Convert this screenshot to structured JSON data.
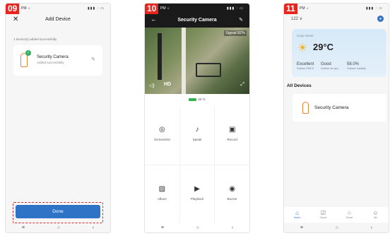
{
  "screens": [
    {
      "step": "09",
      "status": {
        "time": "PM ☼",
        "icons": "▮▮▮ ∶ ▭"
      },
      "header": {
        "close_icon": "✕",
        "title": "Add Device"
      },
      "added_text": "1 device(s) added successfully",
      "device": {
        "name": "Security Camera",
        "status": "Added successfully",
        "edit_icon": "✎"
      },
      "done_label": "Done",
      "nav": [
        "≡",
        "○",
        "‹"
      ]
    },
    {
      "step": "10",
      "status": {
        "time": "PM ☼",
        "icons": "▮▮▮ ∶ ▭"
      },
      "header": {
        "back_icon": "←",
        "title": "Security Camera",
        "edit_icon": "✎"
      },
      "signal": "Signal:92%",
      "hd_label": "HD",
      "battery": "60 %",
      "controls": [
        {
          "icon": "◎",
          "label": "Screenshot"
        },
        {
          "icon": "♪",
          "label": "Speak"
        },
        {
          "icon": "▣",
          "label": "Record"
        },
        {
          "icon": "▨",
          "label": "Album"
        },
        {
          "icon": "▶",
          "label": "Playback"
        },
        {
          "icon": "◉",
          "label": "Buzzer"
        }
      ],
      "nav": [
        "≡",
        "○",
        "‹"
      ]
    },
    {
      "step": "11",
      "status": {
        "time": "PM ☼",
        "icons": "▮▮▮ ∶ ▭"
      },
      "home_selector": "122 ∨",
      "weather": {
        "label": "Cozy Home",
        "temperature": "29°C",
        "items": [
          {
            "value": "Excellent",
            "label": "Outdoor PM2.5"
          },
          {
            "value": "Good",
            "label": "Outdoor air qua..."
          },
          {
            "value": "58.0%",
            "label": "Outdoor humidity"
          }
        ]
      },
      "section_title": "All Devices",
      "device_name": "Security Camera",
      "tabs": [
        {
          "icon": "⌂",
          "label": "Home"
        },
        {
          "icon": "☑",
          "label": "Scene"
        },
        {
          "icon": "☆",
          "label": "Smart"
        },
        {
          "icon": "☺",
          "label": "Me"
        }
      ],
      "nav": [
        "≡",
        "○",
        "‹"
      ]
    }
  ]
}
